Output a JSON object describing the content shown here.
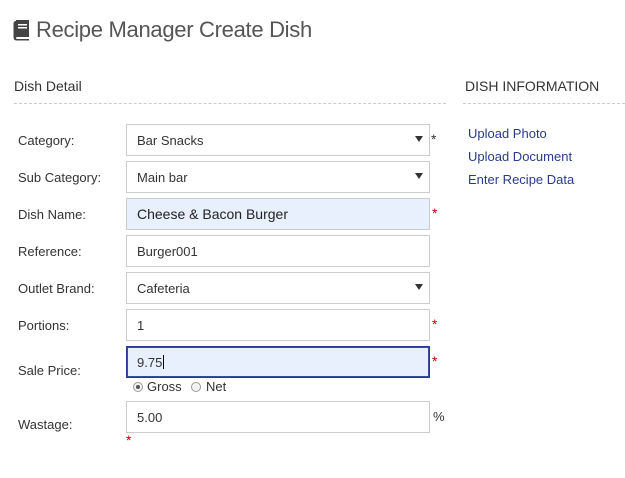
{
  "header": {
    "title": "Recipe Manager Create Dish",
    "icon": "book-icon"
  },
  "dish_detail": {
    "heading": "Dish Detail"
  },
  "dish_information": {
    "heading": "DISH INFORMATION",
    "links": [
      "Upload Photo",
      "Upload Document",
      "Enter Recipe Data"
    ]
  },
  "form": {
    "category": {
      "label": "Category:",
      "value": "Bar Snacks",
      "required_mark": "*"
    },
    "sub_category": {
      "label": "Sub Category:",
      "value": "Main bar"
    },
    "dish_name": {
      "label": "Dish Name:",
      "value": "Cheese & Bacon Burger",
      "required_mark": "*"
    },
    "reference": {
      "label": "Reference:",
      "value": "Burger001"
    },
    "outlet_brand": {
      "label": "Outlet Brand:",
      "value": "Cafeteria"
    },
    "portions": {
      "label": "Portions:",
      "value": "1",
      "required_mark": "*"
    },
    "sale_price": {
      "label": "Sale Price:",
      "value": "9.75",
      "required_mark": "*",
      "options": [
        "Gross",
        "Net"
      ],
      "selected": "Gross"
    },
    "wastage": {
      "label": "Wastage:",
      "value": "5.00",
      "unit": "%",
      "required_mark": "*"
    }
  },
  "colors": {
    "link": "#2a3a8e",
    "required": "#c00000",
    "highlight_bg": "#e8f0fe"
  }
}
